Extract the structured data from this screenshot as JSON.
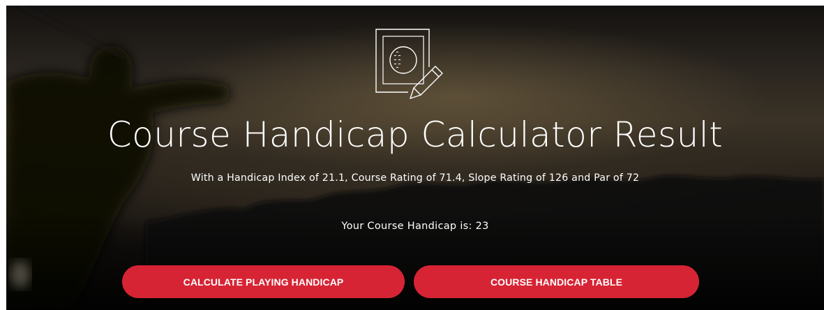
{
  "hero": {
    "icon": "golf-ball-scorecard-pencil-icon",
    "title": "Course Handicap Calculator Result",
    "subtitle": "With a Handicap Index of 21.1, Course Rating of 71.4, Slope Rating of 126 and Par of 72",
    "result_text": "Your Course Handicap is: 23"
  },
  "buttons": {
    "playing_handicap_label": "CALCULATE PLAYING HANDICAP",
    "table_label": "COURSE HANDICAP TABLE"
  },
  "colors": {
    "button_bg": "#d62434",
    "text": "#ffffff",
    "hero_dark": "#14110e"
  }
}
